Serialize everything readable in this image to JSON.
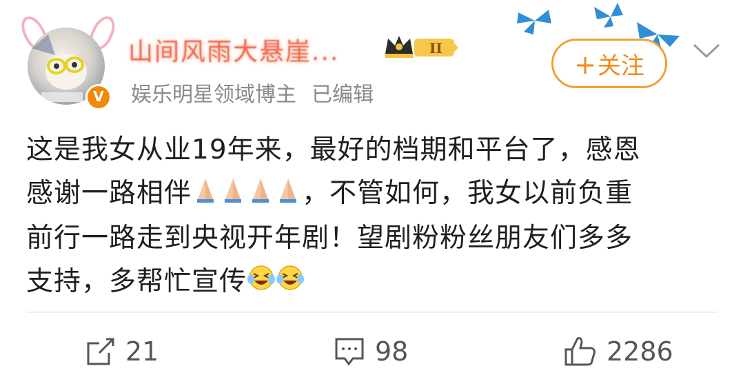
{
  "user": {
    "name": "山间风雨大悬崖...",
    "level": "II",
    "verified_mark": "V",
    "title": "娱乐明星领域博主",
    "edited": "已编辑"
  },
  "follow_button": {
    "plus": "+",
    "label": "关注"
  },
  "post": {
    "lines": [
      "这是我女从业19年来，最好的档期和平台了，感恩",
      "感谢一路相伴",
      "，不管如何，我女以前负重",
      "前行一路走到央视开年剧！望剧粉粉丝朋友们多多",
      "支持，多帮忙宣传"
    ]
  },
  "actions": {
    "share_count": "21",
    "comment_count": "98",
    "like_count": "2286"
  },
  "icons": {
    "avatar": "avatar-image",
    "verified": "verified-v-icon",
    "level": "crown-level-icon",
    "butterfly": "butterfly-icon",
    "more": "chevron-down-icon",
    "pray": "pray-hands-emoji",
    "laugh_cry": "laugh-cry-emoji",
    "share": "share-icon",
    "comment": "comment-icon",
    "like": "thumb-up-icon"
  },
  "colors": {
    "accent": "#f08a1e",
    "username": "#ee6a4a",
    "butterfly": "#2f8fd6",
    "text": "#1f1f1f",
    "muted": "#8a8a8a"
  }
}
